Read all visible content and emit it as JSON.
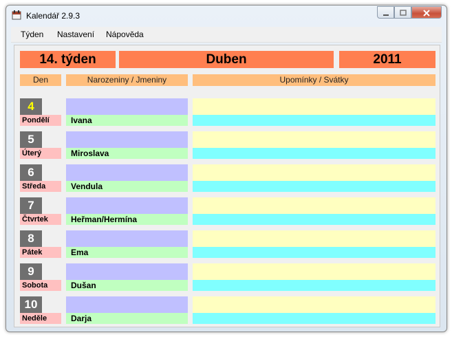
{
  "window": {
    "title": "Kalendář  2.9.3"
  },
  "menu": [
    "Týden",
    "Nastavení",
    "Nápověda"
  ],
  "header": {
    "week": "14. týden",
    "month": "Duben",
    "year": "2011"
  },
  "columns": {
    "day": "Den",
    "birthdays": "Narozeniny / Jmeniny",
    "reminders": "Upomínky / Svátky"
  },
  "days": [
    {
      "num": "4",
      "name": "Pondělí",
      "nameday": "Ivana",
      "reminder": "",
      "holiday": ""
    },
    {
      "num": "5",
      "name": "Úterý",
      "nameday": "Miroslava",
      "reminder": "",
      "holiday": ""
    },
    {
      "num": "6",
      "name": "Středa",
      "nameday": "Vendula",
      "reminder": "",
      "holiday": ""
    },
    {
      "num": "7",
      "name": "Čtvrtek",
      "nameday": "Heřman/Hermína",
      "reminder": "",
      "holiday": ""
    },
    {
      "num": "8",
      "name": "Pátek",
      "nameday": "Ema",
      "reminder": "",
      "holiday": ""
    },
    {
      "num": "9",
      "name": "Sobota",
      "nameday": "Dušan",
      "reminder": "",
      "holiday": ""
    },
    {
      "num": "10",
      "name": "Neděle",
      "nameday": "Darja",
      "reminder": "",
      "holiday": ""
    }
  ],
  "colors": {
    "header": "#ff7f50",
    "column_header": "#ffbe7d",
    "today_number": "#ffff00"
  }
}
